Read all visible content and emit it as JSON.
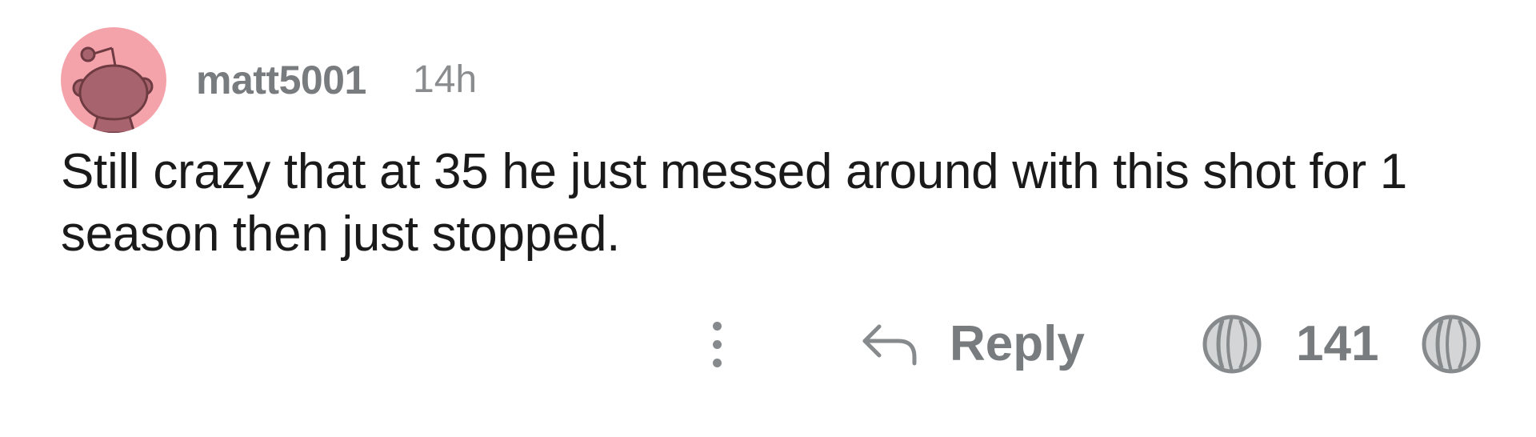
{
  "comment": {
    "author": "matt5001",
    "timestamp": "14h",
    "body": "Still crazy that at 35 he just messed around with this shot for 1 season then just stopped.",
    "avatar_icon": "snoo-avatar-icon",
    "avatar_color": "#f5a3ab"
  },
  "actions": {
    "more_icon": "more-vertical-icon",
    "reply_icon": "reply-arrow-icon",
    "reply_label": "Reply",
    "upvote_icon": "basketball-upvote-icon",
    "vote_count": "141",
    "downvote_icon": "basketball-downvote-icon",
    "icon_color": "#878a8c"
  }
}
